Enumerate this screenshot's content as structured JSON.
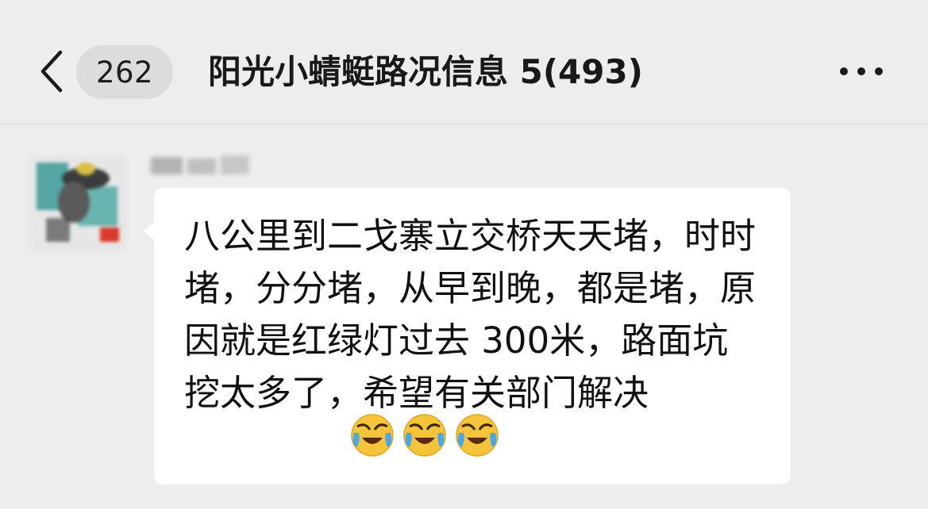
{
  "header": {
    "unread_count": "262",
    "title": "阳光小蜻蜓路况信息 5(493)",
    "back_icon": "chevron-left-icon",
    "more_icon": "more-dots-icon"
  },
  "message": {
    "text": "八公里到二戈寨立交桥天天堵，时时堵，分分堵，从早到晚，都是堵，原因就是红绿灯过去 300米，路面坑挖太多了，希望有关部门解决",
    "emojis": [
      "face-with-tears-of-joy-icon",
      "face-with-tears-of-joy-icon",
      "face-with-tears-of-joy-icon"
    ]
  },
  "colors": {
    "background": "#ededed",
    "bubble": "#ffffff",
    "badge": "#dcdcdc",
    "text": "#111111"
  }
}
